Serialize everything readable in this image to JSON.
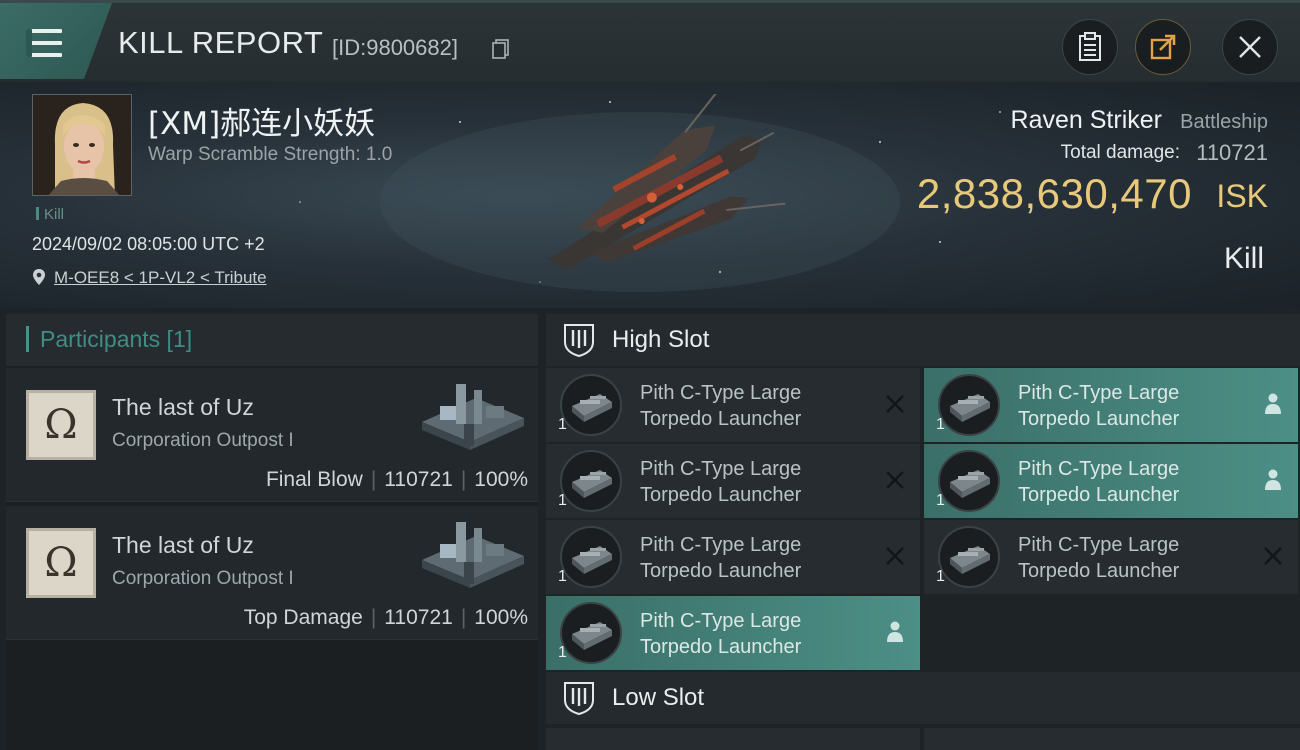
{
  "header": {
    "title": "KILL REPORT",
    "report_id": "[ID:9800682]"
  },
  "banner": {
    "pilot_name": "[XM]郝连小妖妖",
    "warp_scramble": "Warp Scramble Strength: 1.0",
    "kill_tag": "Kill",
    "datetime": "2024/09/02 08:05:00 UTC +2",
    "location": "M-OEE8 < 1P-VL2 < Tribute",
    "ship_name": "Raven Striker",
    "ship_class": "Battleship",
    "total_damage_label": "Total damage:",
    "total_damage_value": "110721",
    "isk_value": "2,838,630,470",
    "isk_unit": "ISK",
    "result": "Kill"
  },
  "participants": {
    "header": "Participants [1]",
    "rows": [
      {
        "name": "The last of Uz",
        "ship": "Corporation Outpost I",
        "role": "Final Blow",
        "damage": "110721",
        "percent": "100%"
      },
      {
        "name": "The last of Uz",
        "ship": "Corporation Outpost I",
        "role": "Top Damage",
        "damage": "110721",
        "percent": "100%"
      }
    ]
  },
  "slots": {
    "high_slot_label": "High Slot",
    "low_slot_label": "Low Slot",
    "modules": [
      {
        "line1": "Pith C-Type Large",
        "line2": "Torpedo Launcher",
        "qty": "1",
        "status": "destroyed",
        "active": false
      },
      {
        "line1": "Pith C-Type Large",
        "line2": "Torpedo Launcher",
        "qty": "1",
        "status": "dropped",
        "active": true
      },
      {
        "line1": "Pith C-Type Large",
        "line2": "Torpedo Launcher",
        "qty": "1",
        "status": "destroyed",
        "active": false
      },
      {
        "line1": "Pith C-Type Large",
        "line2": "Torpedo Launcher",
        "qty": "1",
        "status": "dropped",
        "active": true
      },
      {
        "line1": "Pith C-Type Large",
        "line2": "Torpedo Launcher",
        "qty": "1",
        "status": "destroyed",
        "active": false
      },
      {
        "line1": "Pith C-Type Large",
        "line2": "Torpedo Launcher",
        "qty": "1",
        "status": "destroyed",
        "active": false
      },
      {
        "line1": "Pith C-Type Large",
        "line2": "Torpedo Launcher",
        "qty": "1",
        "status": "dropped",
        "active": true
      }
    ]
  },
  "colors": {
    "accent_teal": "#4c8f86",
    "isk_gold": "#e8c97a"
  }
}
